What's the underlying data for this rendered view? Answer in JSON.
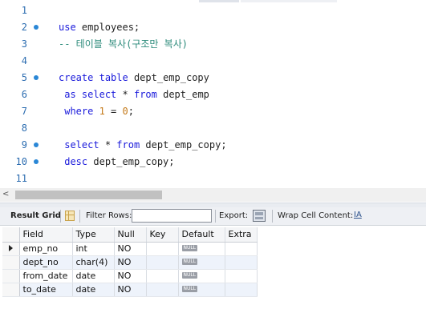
{
  "editor": {
    "lines": [
      {
        "num": "1",
        "marker": false,
        "tokens": []
      },
      {
        "num": "2",
        "marker": true,
        "tokens": [
          {
            "t": "use",
            "c": "kw"
          },
          {
            "t": " employees;",
            "c": ""
          }
        ]
      },
      {
        "num": "3",
        "marker": false,
        "tokens": [
          {
            "t": "-- 테이블 복사(구조만 복사)",
            "c": "cm"
          }
        ]
      },
      {
        "num": "4",
        "marker": false,
        "tokens": []
      },
      {
        "num": "5",
        "marker": true,
        "tokens": [
          {
            "t": "create",
            "c": "kw"
          },
          {
            "t": " ",
            "c": ""
          },
          {
            "t": "table",
            "c": "kw"
          },
          {
            "t": " dept_emp_copy",
            "c": ""
          }
        ]
      },
      {
        "num": "6",
        "marker": false,
        "tokens": [
          {
            "t": " ",
            "c": ""
          },
          {
            "t": "as",
            "c": "kw"
          },
          {
            "t": " ",
            "c": ""
          },
          {
            "t": "select",
            "c": "kw"
          },
          {
            "t": " * ",
            "c": ""
          },
          {
            "t": "from",
            "c": "kw"
          },
          {
            "t": " dept_emp",
            "c": ""
          }
        ]
      },
      {
        "num": "7",
        "marker": false,
        "tokens": [
          {
            "t": " ",
            "c": ""
          },
          {
            "t": "where",
            "c": "kw"
          },
          {
            "t": " ",
            "c": ""
          },
          {
            "t": "1",
            "c": "num"
          },
          {
            "t": " = ",
            "c": ""
          },
          {
            "t": "0",
            "c": "num"
          },
          {
            "t": ";",
            "c": ""
          }
        ]
      },
      {
        "num": "8",
        "marker": false,
        "tokens": []
      },
      {
        "num": "9",
        "marker": true,
        "tokens": [
          {
            "t": " ",
            "c": ""
          },
          {
            "t": "select",
            "c": "kw"
          },
          {
            "t": " * ",
            "c": ""
          },
          {
            "t": "from",
            "c": "kw"
          },
          {
            "t": " dept_emp_copy;",
            "c": ""
          }
        ]
      },
      {
        "num": "10",
        "marker": true,
        "tokens": [
          {
            "t": " ",
            "c": ""
          },
          {
            "t": "desc",
            "c": "kw"
          },
          {
            "t": " dept_emp_copy;",
            "c": ""
          }
        ]
      },
      {
        "num": "11",
        "marker": false,
        "tokens": []
      }
    ]
  },
  "toolbar": {
    "result_grid_label": "Result Grid",
    "grid_icon": "grid-icon",
    "filter_rows_label": "Filter Rows:",
    "filter_rows_value": "",
    "export_label": "Export:",
    "export_icon": "export-icon",
    "wrap_label": "Wrap Cell Content:",
    "wrap_icon_glyph": "IA"
  },
  "grid": {
    "columns": [
      "Field",
      "Type",
      "Null",
      "Key",
      "Default",
      "Extra"
    ],
    "null_badge": "NULL",
    "rows": [
      {
        "field": "emp_no",
        "type": "int",
        "null": "NO",
        "key": "",
        "extra": "",
        "current": true
      },
      {
        "field": "dept_no",
        "type": "char(4)",
        "null": "NO",
        "key": "",
        "extra": "",
        "current": false
      },
      {
        "field": "from_date",
        "type": "date",
        "null": "NO",
        "key": "",
        "extra": "",
        "current": false
      },
      {
        "field": "to_date",
        "type": "date",
        "null": "NO",
        "key": "",
        "extra": "",
        "current": false
      }
    ]
  },
  "colors": {
    "keyword": "#1a1adb",
    "comment": "#2b8a7a",
    "number": "#c47a1a",
    "line_number": "#2b6cb0",
    "marker": "#2a87d6",
    "alt_row": "#eef3fb"
  }
}
